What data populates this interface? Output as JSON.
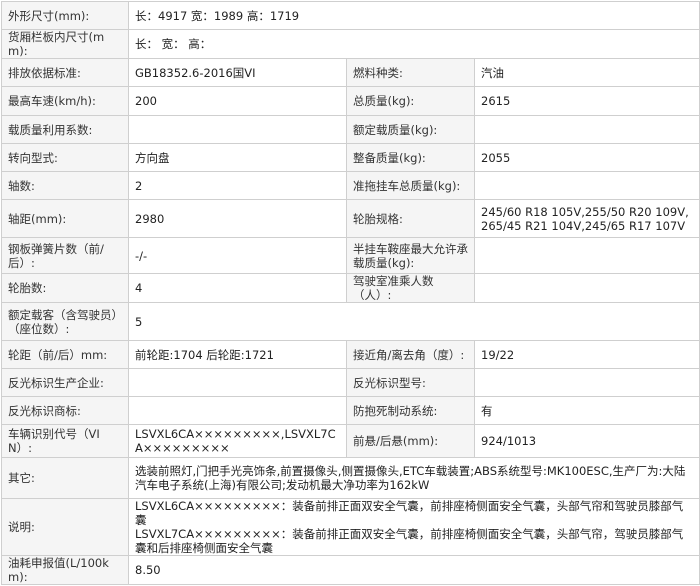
{
  "rows": [
    {
      "label": "外形尺寸(mm):",
      "value": "长：4917 宽：1989 高：1719"
    },
    {
      "label": "货厢栏板内尺寸(mm):",
      "value": "长： 宽： 高："
    },
    {
      "label": "排放依据标准:",
      "value": "GB18352.6-2016国VI",
      "label2": "燃料种类:",
      "value2": "汽油"
    },
    {
      "label": "最高车速(km/h):",
      "value": "200",
      "label2": "总质量(kg):",
      "value2": "2615"
    },
    {
      "label": "载质量利用系数:",
      "value": "",
      "label2": "额定载质量(kg):",
      "value2": ""
    },
    {
      "label": "转向型式:",
      "value": "方向盘",
      "label2": "整备质量(kg):",
      "value2": "2055"
    },
    {
      "label": "轴数:",
      "value": "2",
      "label2": "准拖挂车总质量(kg):",
      "value2": ""
    },
    {
      "label": "轴距(mm):",
      "value": "2980",
      "label2": "轮胎规格:",
      "value2": "245/60 R18 105V,255/50 R20 109V,265/45 R21 104V,245/65 R17 107V"
    },
    {
      "label": "钢板弹簧片数（前/后）:",
      "value": "-/-",
      "label2": "半挂车鞍座最大允许承载质量(kg):",
      "value2": ""
    },
    {
      "label": "轮胎数:",
      "value": "4",
      "label2": "驾驶室准乘人数（人）:",
      "value2": ""
    },
    {
      "label": "额定载客（含驾驶员）（座位数）:",
      "value": "5"
    },
    {
      "label": "轮距（前/后）mm:",
      "value": "前轮距:1704 后轮距:1721",
      "label2": "接近角/离去角（度）:",
      "value2": "19/22"
    },
    {
      "label": "反光标识生产企业:",
      "value": "",
      "label2": "反光标识型号:",
      "value2": ""
    },
    {
      "label": "反光标识商标:",
      "value": "",
      "label2": "防抱死制动系统:",
      "value2": "有"
    },
    {
      "label": "车辆识别代号（VIN）:",
      "value": "LSVXL6CA×××××××××,LSVXL7CA×××××××××",
      "label2": "前悬/后悬(mm):",
      "value2": "924/1013"
    },
    {
      "label": "其它:",
      "value": "选装前照灯,门把手光亮饰条,前置摄像头,侧置摄像头,ETC车载装置;ABS系统型号:MK100ESC,生产厂为:大陆汽车电子系统(上海)有限公司;发动机最大净功率为162kW"
    },
    {
      "label": "说明:",
      "value": "LSVXL6CA×××××××××：装备前排正面双安全气囊，前排座椅侧面安全气囊，头部气帘和驾驶员膝部气囊\nLSVXL7CA×××××××××：装备前排正面双安全气囊，前排座椅侧面安全气囊，头部气帘，驾驶员膝部气囊和后排座椅侧面安全气囊"
    },
    {
      "label": "油耗申报值(L/100km):",
      "value": "8.50"
    }
  ]
}
